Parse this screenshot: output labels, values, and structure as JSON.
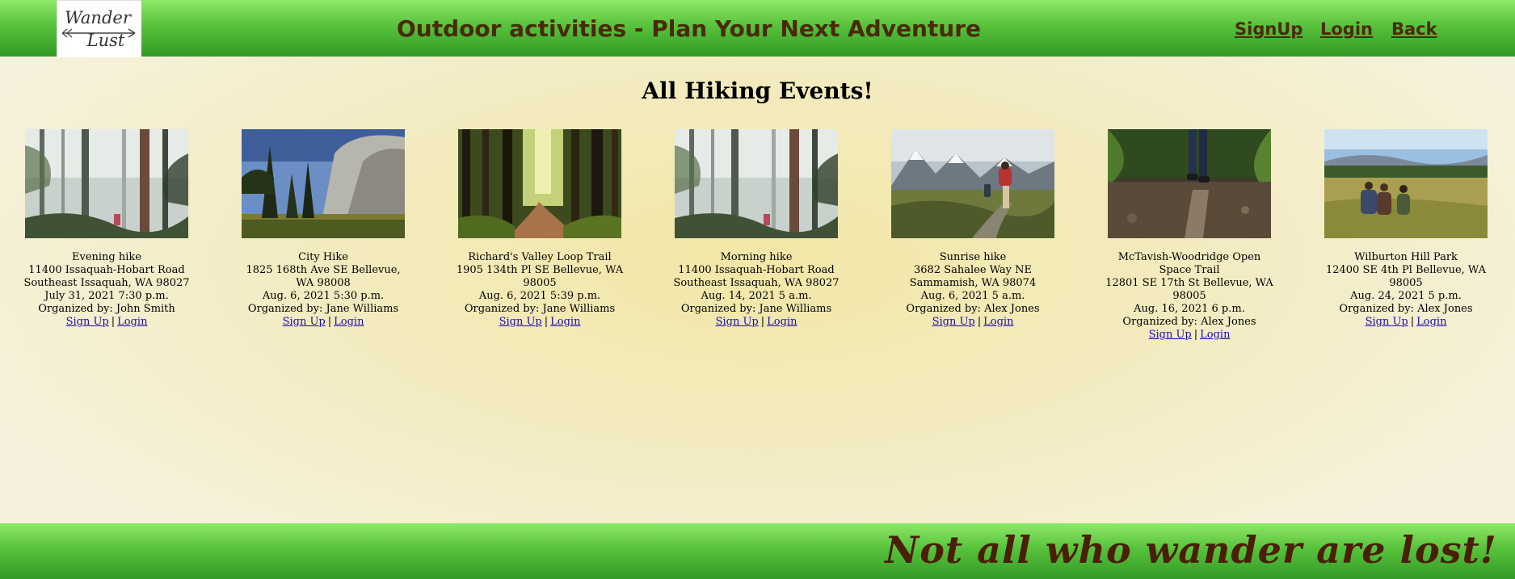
{
  "header": {
    "logo_text": "Wander Lust",
    "title": "Outdoor activities - Plan Your Next Adventure",
    "nav": {
      "signup": "SignUp",
      "login": "Login",
      "back": "Back"
    }
  },
  "page": {
    "heading": "All Hiking Events!"
  },
  "events": [
    {
      "name": "Evening hike",
      "address": "11400 Issaquah-Hobart Road Southeast Issaquah, WA 98027",
      "date": "July 31, 2021 7:30 p.m.",
      "organizer": "Organized by: John Smith",
      "signup": "Sign Up",
      "sep": "|",
      "login": "Login",
      "image": "misty-forest"
    },
    {
      "name": "City Hike",
      "address": "1825 168th Ave SE Bellevue, WA 98008",
      "date": "Aug. 6, 2021 5:30 p.m.",
      "organizer": "Organized by: Jane Williams",
      "signup": "Sign Up",
      "sep": "|",
      "login": "Login",
      "image": "granite-cliff"
    },
    {
      "name": "Richard's Valley Loop Trail",
      "address": "1905 134th Pl SE Bellevue, WA 98005",
      "date": "Aug. 6, 2021 5:39 p.m.",
      "organizer": "Organized by: Jane Williams",
      "signup": "Sign Up",
      "sep": "|",
      "login": "Login",
      "image": "forest-path"
    },
    {
      "name": "Morning hike",
      "address": "11400 Issaquah-Hobart Road Southeast Issaquah, WA 98027",
      "date": "Aug. 14, 2021 5 a.m.",
      "organizer": "Organized by: Jane Williams",
      "signup": "Sign Up",
      "sep": "|",
      "login": "Login",
      "image": "misty-forest"
    },
    {
      "name": "Sunrise hike",
      "address": "3682 Sahalee Way NE Sammamish, WA 98074",
      "date": "Aug. 6, 2021 5 a.m.",
      "organizer": "Organized by: Alex Jones",
      "signup": "Sign Up",
      "sep": "|",
      "login": "Login",
      "image": "mountain-hikers"
    },
    {
      "name": "McTavish-Woodridge Open Space Trail",
      "address": "12801 SE 17th St Bellevue, WA 98005",
      "date": "Aug. 16, 2021 6 p.m.",
      "organizer": "Organized by: Alex Jones",
      "signup": "Sign Up",
      "sep": "|",
      "login": "Login",
      "image": "log-walk"
    },
    {
      "name": "Wilburton Hill Park",
      "address": "12400 SE 4th Pl Bellevue, WA 98005",
      "date": "Aug. 24, 2021 5 p.m.",
      "organizer": "Organized by: Alex Jones",
      "signup": "Sign Up",
      "sep": "|",
      "login": "Login",
      "image": "meadow-hikers"
    }
  ],
  "footer": {
    "tagline": "Not all who wander are lost!"
  },
  "colors": {
    "header_green": "#58c23c",
    "brand_brown": "#4a2a05",
    "link_blue": "#1a0dab"
  }
}
